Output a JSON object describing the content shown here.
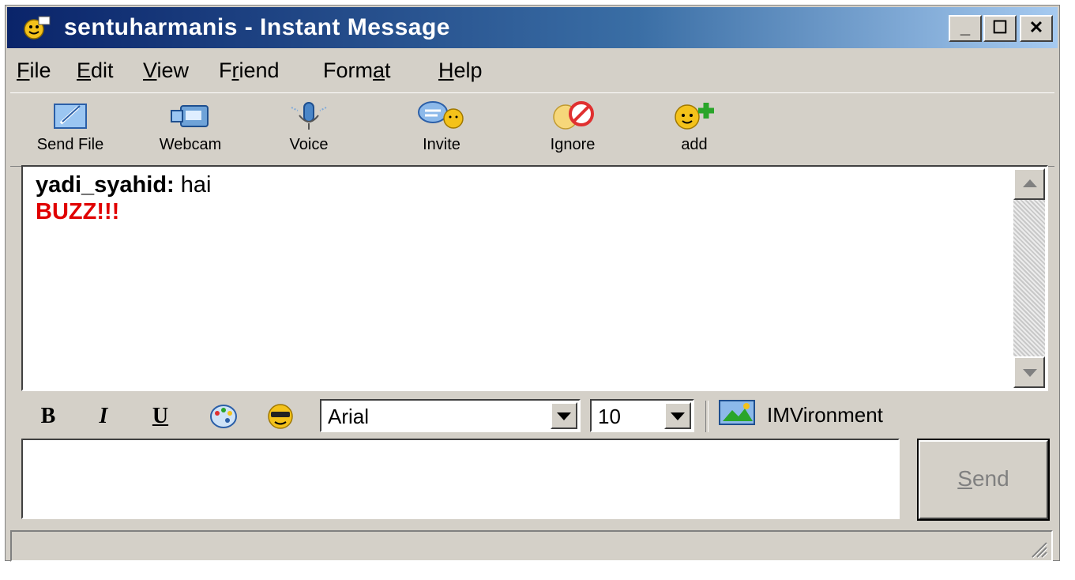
{
  "window": {
    "title": "sentuharmanis - Instant Message",
    "controls": [
      "_",
      "☐",
      "✕"
    ]
  },
  "menu": [
    {
      "label": "File",
      "mnemonic": "F",
      "rest": "ile"
    },
    {
      "label": "Edit",
      "mnemonic": "E",
      "rest": "dit"
    },
    {
      "label": "View",
      "mnemonic": "V",
      "rest": "iew"
    },
    {
      "label": "Friend",
      "mnemonic": "r",
      "pre": "F",
      "rest": "iend"
    },
    {
      "label": "Format",
      "mnemonic": "a",
      "pre": "Form",
      "rest": "t"
    },
    {
      "label": "Help",
      "mnemonic": "H",
      "rest": "elp"
    }
  ],
  "toolbar": [
    {
      "label": "Send File",
      "icon": "send-file-icon"
    },
    {
      "label": "Webcam",
      "icon": "webcam-icon"
    },
    {
      "label": "Voice",
      "icon": "microphone-icon"
    },
    {
      "label": "Invite",
      "icon": "invite-icon"
    },
    {
      "label": "Ignore",
      "icon": "ignore-icon"
    },
    {
      "label": "add",
      "icon": "add-friend-icon"
    }
  ],
  "chat": {
    "sender": "yadi_syahid:",
    "message": "hai",
    "buzz": "BUZZ!!!"
  },
  "format": {
    "bold": "B",
    "italic": "I",
    "underline": "U",
    "font": "Arial",
    "size": "10",
    "imvironment": "IMVironment"
  },
  "input": {
    "value": ""
  },
  "send": {
    "label": "Send",
    "mnemonic": "S",
    "rest": "end"
  },
  "colors": {
    "titlebar": "#0a246a",
    "buzz": "#e00000",
    "face": "#d4d0c8"
  }
}
